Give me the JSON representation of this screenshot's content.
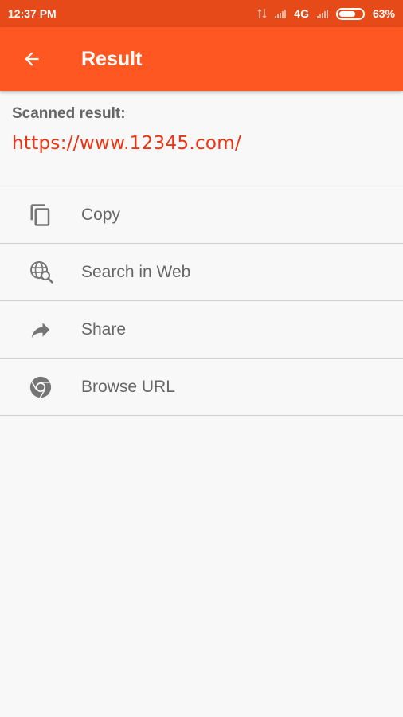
{
  "status_bar": {
    "time": "12:37 PM",
    "network": "4G",
    "battery": "63%",
    "battery_level": 0.63
  },
  "app_bar": {
    "title": "Result",
    "back_icon": "arrow-back-icon"
  },
  "result": {
    "label": "Scanned result:",
    "value": "https://www.12345.com/"
  },
  "actions": [
    {
      "label": "Copy",
      "icon": "copy-icon"
    },
    {
      "label": "Search in Web",
      "icon": "web-search-icon"
    },
    {
      "label": "Share",
      "icon": "share-icon"
    },
    {
      "label": "Browse URL",
      "icon": "chrome-icon"
    }
  ],
  "colors": {
    "status_bar": "#e64a19",
    "app_bar": "#ff5722",
    "result_text": "#ef3312",
    "background": "#f8f8f8"
  }
}
